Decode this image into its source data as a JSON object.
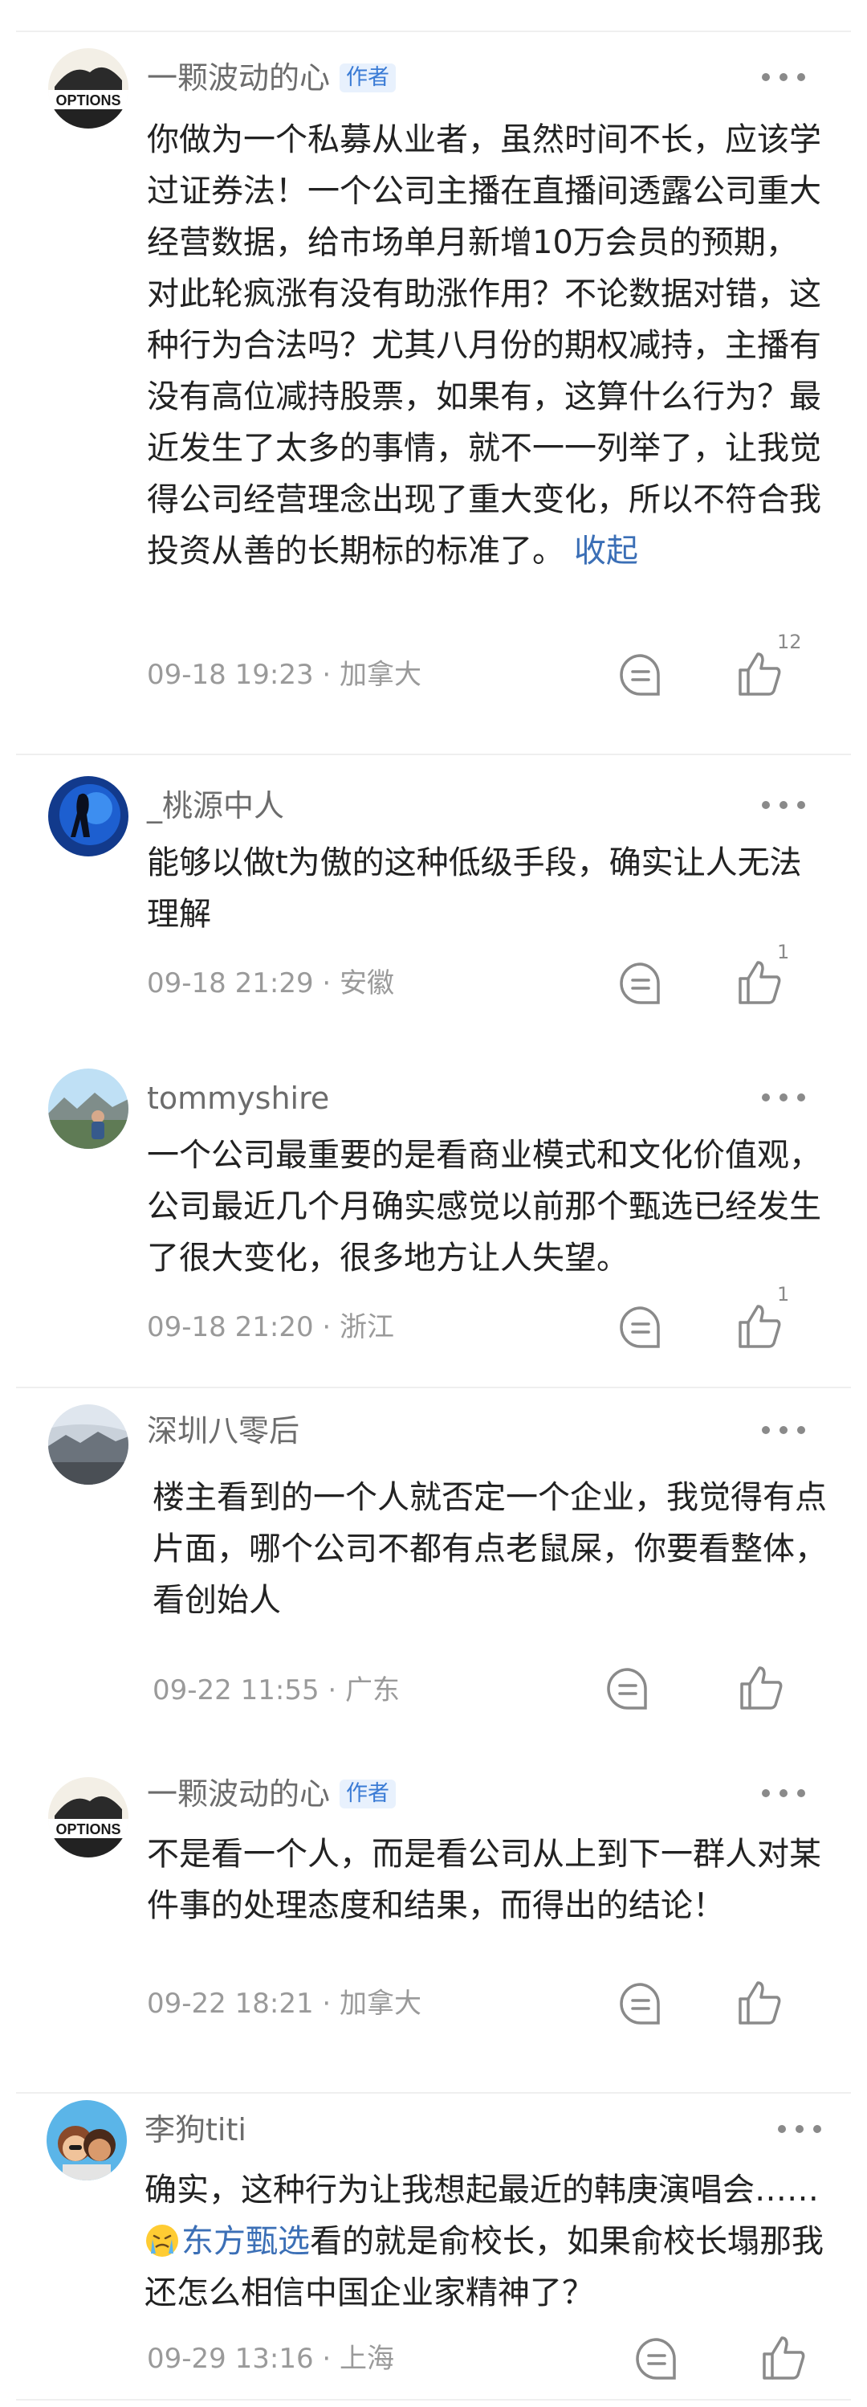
{
  "comments": [
    {
      "username": "一颗波动的心",
      "badge": "作者",
      "avatar_text": "OPTIONS",
      "body": "你做为一个私募从业者，虽然时间不长，应该学过证券法！一个公司主播在直播间透露公司重大经营数据，给市场单月新增10万会员的预期，对此轮疯涨有没有助涨作用？不论数据对错，这种行为合法吗？尤其八月份的期权减持，主播有没有高位减持股票，如果有，这算什么行为？最近发生了太多的事情，就不一一列举了，让我觉得公司经营理念出现了重大变化，所以不符合我投资从善的长期标的标准了。",
      "collapse_label": "收起",
      "timestamp": "09-18 19:23",
      "location": "加拿大",
      "likes": "12"
    },
    {
      "username": "_桃源中人",
      "body": "能够以做t为傲的这种低级手段，确实让人无法理解",
      "timestamp": "09-18 21:29",
      "location": "安徽",
      "likes": "1"
    },
    {
      "username": "tommyshire",
      "body": "一个公司最重要的是看商业模式和文化价值观，公司最近几个月确实感觉以前那个甄选已经发生了很大变化，很多地方让人失望。",
      "timestamp": "09-18 21:20",
      "location": "浙江",
      "likes": "1"
    },
    {
      "username": "深圳八零后",
      "body": "楼主看到的一个人就否定一个企业，我觉得有点片面，哪个公司不都有点老鼠屎，你要看整体，看创始人",
      "timestamp": "09-22 11:55",
      "location": "广东",
      "likes": ""
    },
    {
      "username": "一颗波动的心",
      "badge": "作者",
      "avatar_text": "OPTIONS",
      "body": "不是看一个人，而是看公司从上到下一群人对某件事的处理态度和结果，而得出的结论！",
      "timestamp": "09-22 18:21",
      "location": "加拿大",
      "likes": ""
    },
    {
      "username": "李狗titi",
      "body_prefix": "确实，这种行为让我想起最近的韩庚演唱会……",
      "mention": "东方甄选",
      "body_suffix": "看的就是俞校长，如果俞校长塌那我还怎么相信中国企业家精神了？",
      "timestamp": "09-29 13:16",
      "location": "上海",
      "likes": ""
    }
  ],
  "separator": " · ",
  "colors": {
    "link": "#3b6fb6",
    "badge": "#3a7bd5",
    "meta": "#9a9a9a"
  }
}
